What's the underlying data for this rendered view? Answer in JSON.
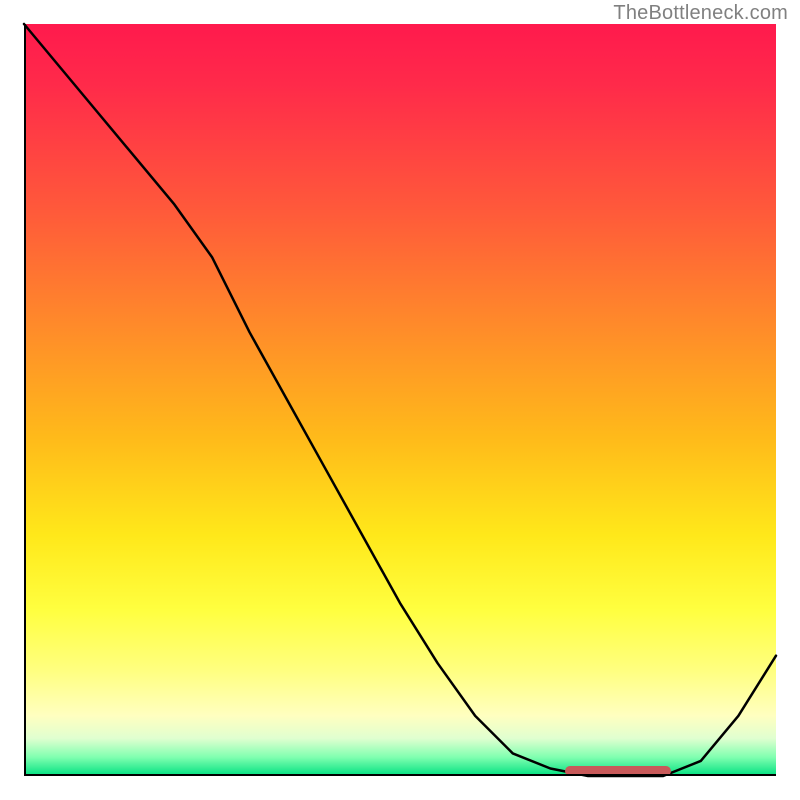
{
  "attribution": "TheBottleneck.com",
  "chart_data": {
    "type": "line",
    "title": "",
    "xlabel": "",
    "ylabel": "",
    "x": [
      0.0,
      0.05,
      0.1,
      0.15,
      0.2,
      0.25,
      0.3,
      0.35,
      0.4,
      0.45,
      0.5,
      0.55,
      0.6,
      0.65,
      0.7,
      0.75,
      0.8,
      0.85,
      0.9,
      0.95,
      1.0
    ],
    "values": [
      1.0,
      0.94,
      0.88,
      0.82,
      0.76,
      0.69,
      0.59,
      0.5,
      0.41,
      0.32,
      0.23,
      0.15,
      0.08,
      0.03,
      0.01,
      0.0,
      0.0,
      0.0,
      0.02,
      0.08,
      0.16
    ],
    "xlim": [
      0,
      1
    ],
    "ylim": [
      0,
      1
    ],
    "marker_region": {
      "x_start": 0.72,
      "x_end": 0.86,
      "y": 0.0
    }
  },
  "colors": {
    "curve": "#000000",
    "marker": "#c85a5a",
    "attribution": "#808080"
  }
}
